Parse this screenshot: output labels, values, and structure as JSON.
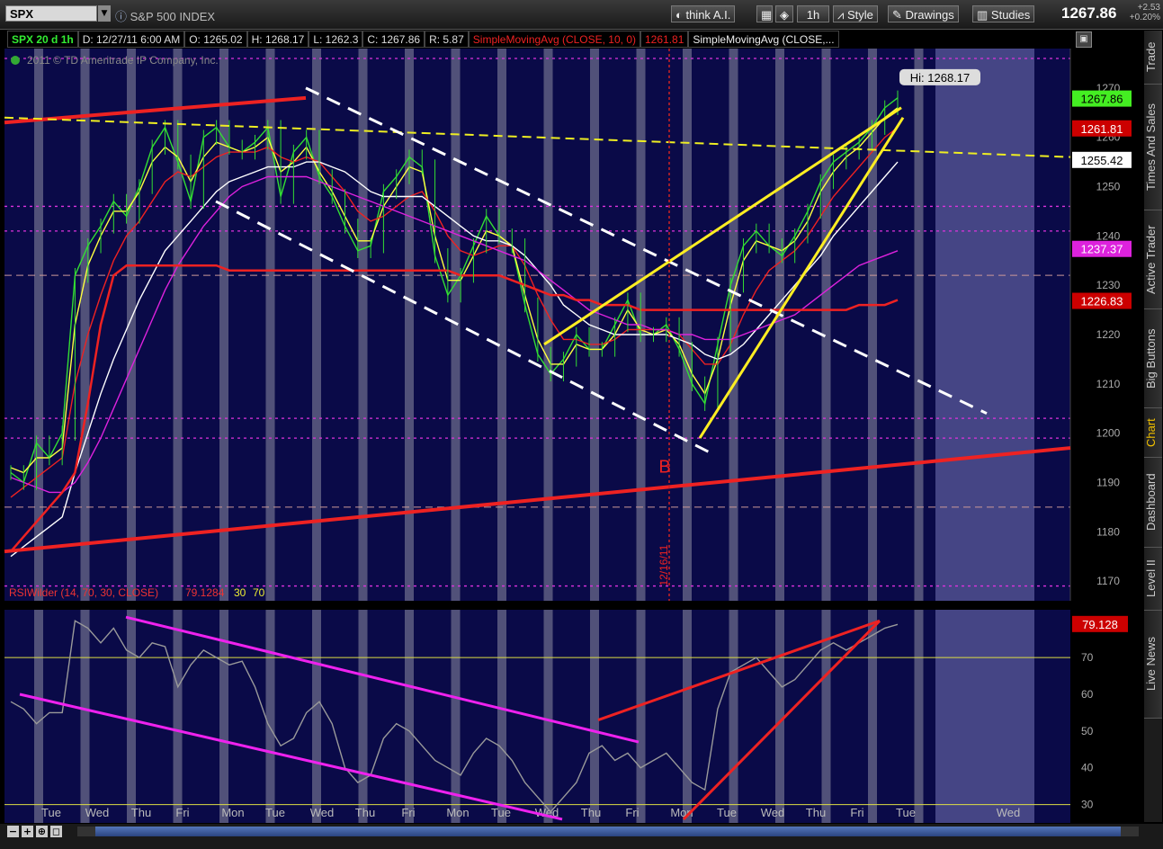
{
  "toolbar": {
    "symbol": "SPX",
    "symbol_name": "S&P 500 INDEX",
    "think_ai": "think A.I.",
    "interval": "1h",
    "style": "Style",
    "drawings": "Drawings",
    "studies": "Studies",
    "last_price": "1267.86",
    "change": "+2.53",
    "change_pct": "+0.20%"
  },
  "infobar": {
    "period": "SPX 20 d 1h",
    "date": "D: 12/27/11 6:00 AM",
    "open": "O: 1265.02",
    "high": "H: 1268.17",
    "low": "L: 1262.3",
    "close": "C: 1267.86",
    "range": "R: 5.87",
    "sma10_label": "SimpleMovingAvg (CLOSE, 10, 0)",
    "sma10_value": "1261.81",
    "sma_label2": "SimpleMovingAvg (CLOSE,..."
  },
  "copyright": "2011 © TD Ameritrade IP Company, Inc.",
  "sidebar": [
    "Trade",
    "Times And Sales",
    "Active Trader",
    "Big Buttons",
    "Chart",
    "Dashboard",
    "Level II",
    "Live News"
  ],
  "sidebar_active": "Chart",
  "chart_data": [
    {
      "type": "line",
      "name": "price",
      "yticks": [
        1170,
        1180,
        1190,
        1200,
        1210,
        1220,
        1230,
        1240,
        1250,
        1260,
        1270
      ],
      "ylim": [
        1166,
        1278
      ],
      "xlabels": [
        "Tue",
        "Wed",
        "Thu",
        "Fri",
        "Mon",
        "Tue",
        "Wed",
        "Thu",
        "Fri",
        "Mon",
        "Tue",
        "Wed",
        "Thu",
        "Fri",
        "Mon",
        "Tue",
        "Wed",
        "Thu",
        "Fri",
        "Tue",
        "Wed"
      ],
      "series": [
        {
          "name": "SPX",
          "color": "#33dd33",
          "values": [
            1192,
            1190,
            1198,
            1195,
            1200,
            1232,
            1238,
            1242,
            1247,
            1244,
            1250,
            1258,
            1262,
            1255,
            1247,
            1260,
            1262,
            1258,
            1257,
            1259,
            1262,
            1248,
            1257,
            1260,
            1252,
            1248,
            1242,
            1237,
            1238,
            1249,
            1252,
            1256,
            1254,
            1236,
            1228,
            1232,
            1238,
            1244,
            1240,
            1238,
            1226,
            1216,
            1212,
            1215,
            1220,
            1217,
            1217,
            1222,
            1227,
            1220,
            1220,
            1222,
            1217,
            1210,
            1206,
            1218,
            1230,
            1238,
            1241,
            1238,
            1236,
            1240,
            1245,
            1251,
            1255,
            1257,
            1259,
            1262,
            1266,
            1268
          ]
        },
        {
          "name": "",
          "color": "#ffff40",
          "values": [
            1193,
            1192,
            1195,
            1195,
            1197,
            1222,
            1234,
            1240,
            1245,
            1245,
            1249,
            1255,
            1258,
            1256,
            1251,
            1256,
            1259,
            1258,
            1257,
            1258,
            1260,
            1253,
            1255,
            1258,
            1253,
            1249,
            1244,
            1239,
            1239,
            1246,
            1250,
            1254,
            1253,
            1240,
            1231,
            1231,
            1236,
            1241,
            1240,
            1238,
            1228,
            1219,
            1214,
            1214,
            1218,
            1217,
            1217,
            1220,
            1225,
            1221,
            1220,
            1221,
            1218,
            1212,
            1208,
            1215,
            1226,
            1235,
            1239,
            1238,
            1237,
            1239,
            1243,
            1249,
            1253,
            1256,
            1258,
            1261,
            1264,
            1266
          ]
        },
        {
          "name": "",
          "color": "#ee2222",
          "values": [
            1187,
            1189,
            1191,
            1193,
            1195,
            1210,
            1220,
            1228,
            1235,
            1240,
            1243,
            1247,
            1251,
            1253,
            1252,
            1254,
            1256,
            1257,
            1257,
            1257,
            1258,
            1256,
            1255,
            1256,
            1255,
            1252,
            1249,
            1245,
            1243,
            1244,
            1246,
            1248,
            1249,
            1245,
            1240,
            1237,
            1236,
            1237,
            1238,
            1238,
            1234,
            1228,
            1223,
            1219,
            1219,
            1218,
            1218,
            1219,
            1221,
            1221,
            1221,
            1221,
            1220,
            1217,
            1214,
            1214,
            1218,
            1224,
            1229,
            1233,
            1235,
            1237,
            1240,
            1244,
            1248,
            1251,
            1254,
            1257,
            1260,
            1262
          ]
        },
        {
          "name": "",
          "color": "#ffffff",
          "values": [
            1175,
            1177,
            1179,
            1181,
            1183,
            1192,
            1200,
            1208,
            1215,
            1221,
            1227,
            1232,
            1237,
            1240,
            1243,
            1246,
            1249,
            1251,
            1252,
            1253,
            1254,
            1254,
            1254,
            1255,
            1255,
            1254,
            1253,
            1251,
            1249,
            1248,
            1248,
            1248,
            1248,
            1246,
            1244,
            1242,
            1240,
            1239,
            1239,
            1238,
            1236,
            1233,
            1230,
            1226,
            1224,
            1222,
            1221,
            1220,
            1220,
            1220,
            1220,
            1220,
            1219,
            1218,
            1216,
            1215,
            1216,
            1218,
            1221,
            1224,
            1227,
            1230,
            1233,
            1236,
            1240,
            1243,
            1246,
            1249,
            1252,
            1255
          ]
        },
        {
          "name": "",
          "color": "#dd22dd",
          "values": [
            1191,
            1190,
            1189,
            1188,
            1188,
            1190,
            1194,
            1199,
            1205,
            1211,
            1217,
            1223,
            1229,
            1234,
            1238,
            1242,
            1245,
            1248,
            1250,
            1251,
            1252,
            1252,
            1252,
            1252,
            1251,
            1250,
            1249,
            1248,
            1247,
            1246,
            1245,
            1244,
            1243,
            1242,
            1241,
            1240,
            1239,
            1238,
            1237,
            1236,
            1235,
            1233,
            1231,
            1229,
            1227,
            1225,
            1224,
            1223,
            1222,
            1222,
            1221,
            1221,
            1220,
            1220,
            1219,
            1219,
            1219,
            1220,
            1221,
            1222,
            1223,
            1224,
            1226,
            1228,
            1230,
            1232,
            1234,
            1235,
            1236,
            1237
          ]
        },
        {
          "name": "",
          "color": "#ee2222",
          "values": [
            1176,
            1179,
            1182,
            1185,
            1188,
            1192,
            1206,
            1222,
            1232,
            1234,
            1234,
            1234,
            1234,
            1234,
            1234,
            1234,
            1234,
            1233,
            1233,
            1233,
            1233,
            1233,
            1233,
            1233,
            1233,
            1233,
            1233,
            1233,
            1233,
            1233,
            1233,
            1233,
            1233,
            1233,
            1233,
            1232,
            1232,
            1232,
            1232,
            1231,
            1230,
            1229,
            1228,
            1228,
            1227,
            1227,
            1226,
            1226,
            1226,
            1225,
            1225,
            1225,
            1225,
            1225,
            1225,
            1225,
            1225,
            1225,
            1225,
            1225,
            1225,
            1225,
            1225,
            1225,
            1225,
            1225,
            1226,
            1226,
            1226,
            1227
          ]
        }
      ],
      "price_labels": [
        {
          "text": "1267.86",
          "bg": "#44ee22",
          "fg": "#000000",
          "value": 1267.86
        },
        {
          "text": "1261.81",
          "bg": "#cc0000",
          "fg": "#ffffff",
          "value": 1261.81
        },
        {
          "text": "1255.42",
          "bg": "#ffffff",
          "fg": "#000000",
          "value": 1255.42
        },
        {
          "text": "1237.37",
          "bg": "#dd22dd",
          "fg": "#ffffff",
          "value": 1237.37
        },
        {
          "text": "1226.83",
          "bg": "#cc0000",
          "fg": "#ffffff",
          "value": 1226.83
        }
      ],
      "annotations": {
        "high": "Hi: 1268.17",
        "marker": "B",
        "date": "12/16/11"
      }
    },
    {
      "type": "line",
      "name": "rsi",
      "title": "RSIWilder (14, 70, 30, CLOSE)",
      "current": "79.1284",
      "levels": [
        "30",
        "70"
      ],
      "yticks": [
        30,
        40,
        50,
        60,
        70
      ],
      "ylim": [
        25,
        83
      ],
      "value_label": "79.128",
      "values": [
        58,
        56,
        52,
        55,
        55,
        80,
        78,
        74,
        78,
        72,
        70,
        74,
        73,
        62,
        68,
        72,
        70,
        68,
        69,
        62,
        52,
        46,
        48,
        55,
        58,
        52,
        40,
        36,
        38,
        48,
        52,
        50,
        46,
        42,
        40,
        38,
        44,
        48,
        46,
        42,
        36,
        32,
        28,
        32,
        36,
        44,
        46,
        42,
        44,
        40,
        42,
        44,
        40,
        36,
        34,
        56,
        66,
        68,
        70,
        66,
        62,
        64,
        68,
        72,
        74,
        72,
        74,
        76,
        78,
        79
      ]
    }
  ]
}
